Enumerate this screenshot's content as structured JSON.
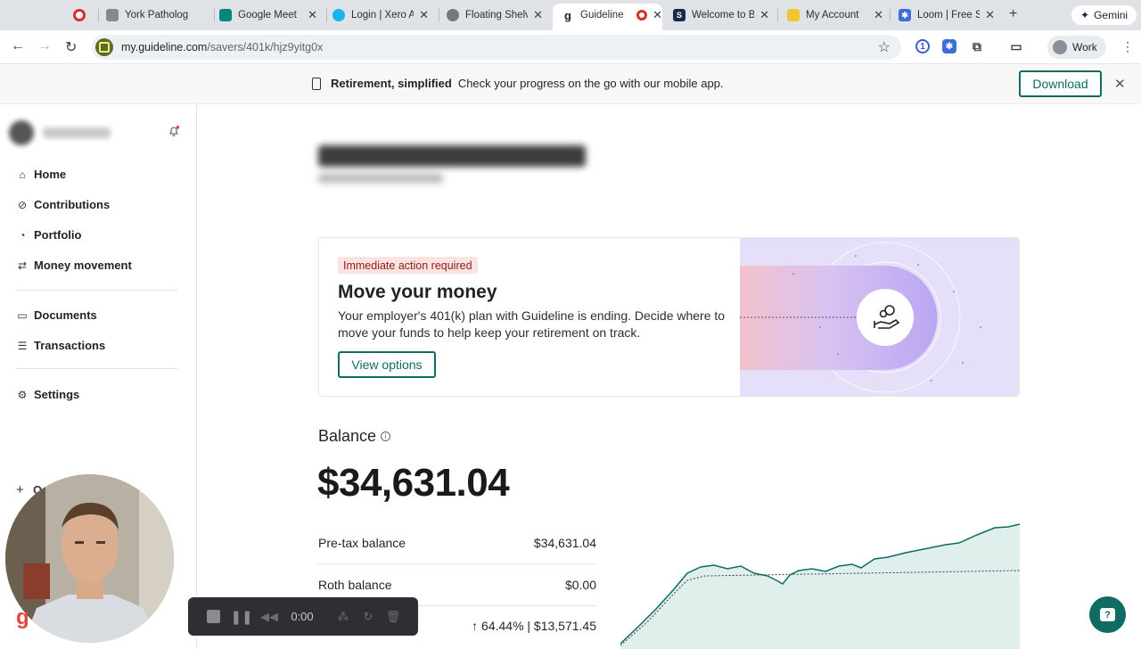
{
  "browser": {
    "tabs": [
      {
        "title": "",
        "favicon": "record-icon"
      },
      {
        "title": "York Patholog",
        "favicon": "york-icon"
      },
      {
        "title": "Google Meet",
        "favicon": "meet-icon"
      },
      {
        "title": "Login | Xero A",
        "favicon": "xero-icon"
      },
      {
        "title": "Floating Shelv",
        "favicon": "globe-icon"
      },
      {
        "title": "Guideline",
        "favicon": "guideline-icon",
        "active": true
      },
      {
        "title": "Welcome to B",
        "favicon": "b-icon"
      },
      {
        "title": "My Account",
        "favicon": "account-icon"
      },
      {
        "title": "Loom | Free S",
        "favicon": "loom-icon"
      }
    ],
    "gemini_label": "Gemini",
    "url_host": "my.guideline.com",
    "url_path": "/savers/401k/hjz9yitg0x",
    "profile_label": "Work"
  },
  "banner": {
    "bold": "Retirement, simplified",
    "text": "Check your progress on the go with our mobile app.",
    "download_label": "Download"
  },
  "sidebar": {
    "items": [
      {
        "label": "Home",
        "icon": "home-icon"
      },
      {
        "label": "Contributions",
        "icon": "contributions-icon"
      },
      {
        "label": "Portfolio",
        "icon": "portfolio-icon"
      },
      {
        "label": "Money movement",
        "icon": "transfer-icon"
      },
      {
        "label": "Documents",
        "icon": "documents-icon"
      },
      {
        "label": "Transactions",
        "icon": "transactions-icon"
      },
      {
        "label": "Settings",
        "icon": "gear-icon"
      }
    ],
    "add_label": "O"
  },
  "alert": {
    "badge": "Immediate action required",
    "title": "Move your money",
    "body": "Your employer's 401(k) plan with Guideline is ending. Decide where to move your funds to help keep your retirement on track.",
    "button": "View options"
  },
  "balance": {
    "label": "Balance",
    "amount": "$34,631.04",
    "rows": [
      {
        "label": "Pre-tax balance",
        "value": "$34,631.04"
      },
      {
        "label": "Roth balance",
        "value": "$0.00"
      },
      {
        "label": "",
        "value": "↑ 64.44% | $13,571.45"
      }
    ]
  },
  "recorder": {
    "timer": "0:00"
  },
  "colors": {
    "brand": "#0f6b63",
    "badge_bg": "#fbe3e1",
    "badge_text": "#8e1c1c",
    "chart_fill": "#dff0ec",
    "chart_line": "#0f6b63"
  }
}
